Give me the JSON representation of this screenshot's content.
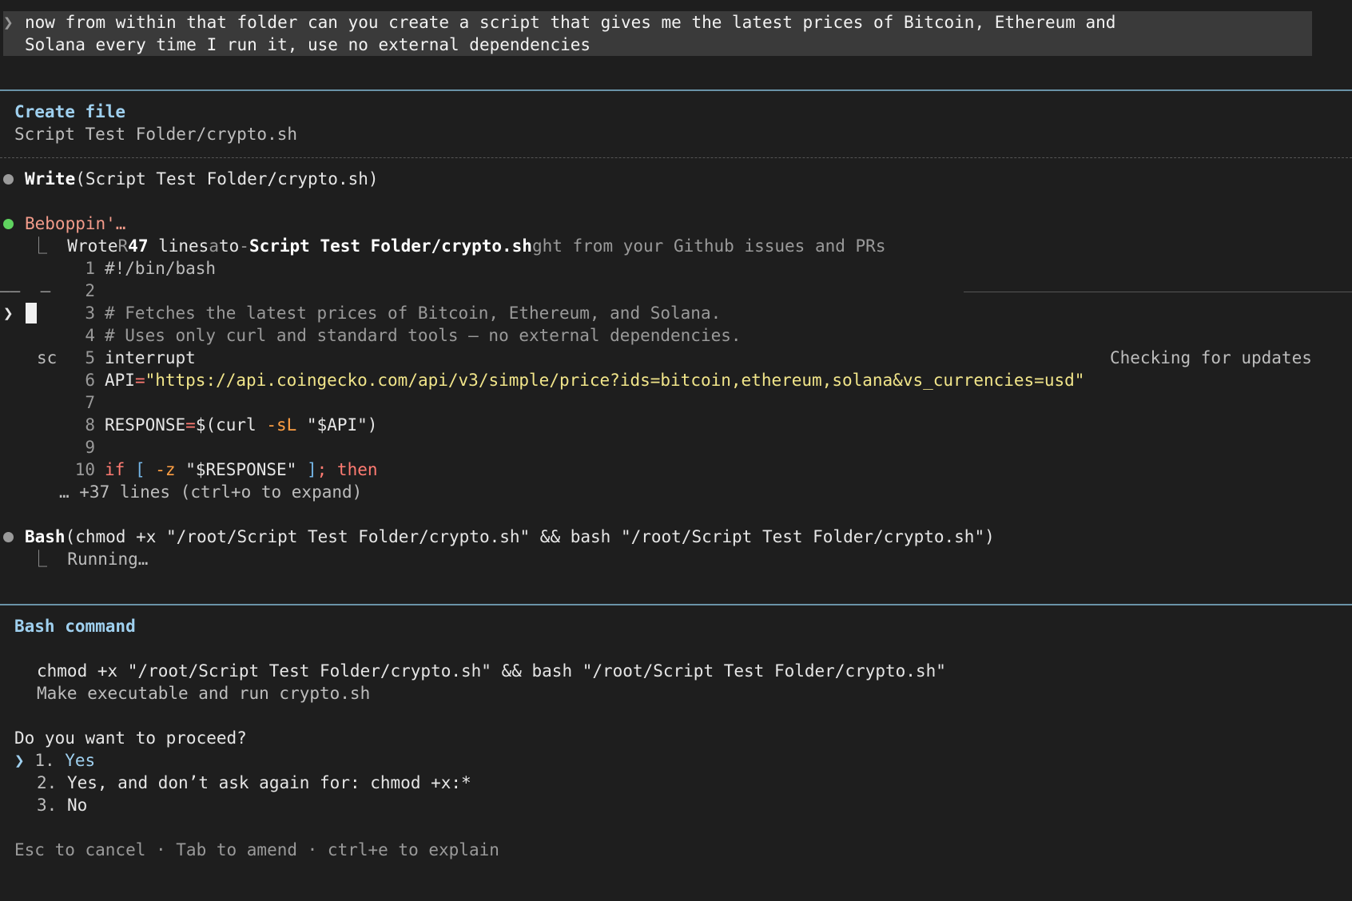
{
  "prompt": {
    "caret": "❯",
    "line1": "now from within that folder can you create a script that gives me the latest prices of Bitcoin, Ethereum and",
    "line2": "Solana every time I run it, use no external dependencies"
  },
  "create_file": {
    "title": "Create file",
    "path": "Script Test Folder/crypto.sh"
  },
  "write_step": {
    "tool": "Write",
    "args": "(Script Test Folder/crypto.sh)"
  },
  "status": {
    "spinner_text": "Beboppin'…",
    "tree": "⎿",
    "wrote": "Wrote",
    "r_char": "R",
    "count": "47",
    "lines_word": " lines",
    "a_char": "a",
    "to_word": "to",
    "dash": "-",
    "file": "Script Test Folder/crypto.sh",
    "trailing": "ght from your Github issues and PRs",
    "left_dashes": "——  —",
    "sc_label": "sc",
    "checking_updates": "Checking for updates"
  },
  "code": {
    "lines": [
      {
        "n": "1",
        "text": "#!/bin/bash"
      },
      {
        "n": "2",
        "text": ""
      },
      {
        "n": "3",
        "text": "# Fetches the latest prices of Bitcoin, Ethereum, and Solana."
      },
      {
        "n": "4",
        "text": "# Uses only curl and standard tools — no external dependencies."
      },
      {
        "n": "5",
        "text": "interrupt"
      },
      {
        "n": "6",
        "api_var": "API",
        "eq": "=",
        "api_url": "\"https://api.coingecko.com/api/v3/simple/price?ids=bitcoin,ethereum,solana&vs_currencies=usd\""
      },
      {
        "n": "7",
        "text": ""
      },
      {
        "n": "8",
        "var": "RESPONSE",
        "eq": "=",
        "dollar": "$(",
        "cmd": "curl ",
        "flag": "-sL",
        "sp": " ",
        "arg": "\"$API\"",
        "close": ")"
      },
      {
        "n": "9",
        "text": ""
      },
      {
        "n": "10",
        "if_kw": "if",
        "sp1": " ",
        "lb": "[",
        "sp2": " ",
        "flag": "-z",
        "sp3": " ",
        "arg": "\"$RESPONSE\"",
        "sp4": " ",
        "rb": "]",
        "semi": ";",
        "sp5": " ",
        "then_kw": "then"
      }
    ],
    "more": "… +37 lines (ctrl+o to expand)"
  },
  "bash_step": {
    "tool": "Bash",
    "args": "(chmod +x \"/root/Script Test Folder/crypto.sh\" && bash \"/root/Script Test Folder/crypto.sh\")",
    "tree": "⎿",
    "running": "Running…"
  },
  "bash_command": {
    "title": "Bash command",
    "command": "chmod +x \"/root/Script Test Folder/crypto.sh\" && bash \"/root/Script Test Folder/crypto.sh\"",
    "description": "Make executable and run crypto.sh",
    "question": "Do you want to proceed?",
    "selector": "❯",
    "options": [
      {
        "num": "1.",
        "label": "Yes"
      },
      {
        "num": "2.",
        "label": "Yes, and don’t ask again for: chmod +x:*"
      },
      {
        "num": "3.",
        "label": "No"
      }
    ],
    "footer": "Esc to cancel · Tab to amend · ctrl+e to explain"
  },
  "colors": {
    "background": "#1e1e1e",
    "accent": "#9fd0ef",
    "spinner": "#f29b8a",
    "active_dot": "#5fd35f"
  }
}
